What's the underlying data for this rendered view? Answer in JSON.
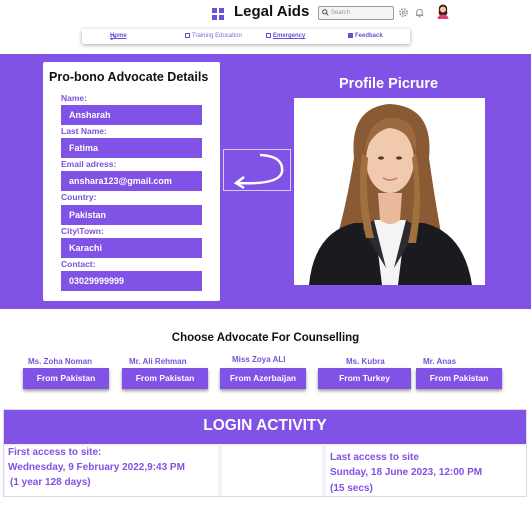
{
  "header": {
    "app_title": "Legal Aids",
    "search_placeholder": "Search",
    "nav": [
      {
        "label": "Home"
      },
      {
        "label": "Training  Education"
      },
      {
        "label": "Emergency"
      },
      {
        "label": "Feedback"
      }
    ]
  },
  "details": {
    "title": "Pro-bono Advocate Details",
    "fields": [
      {
        "label": "Name:",
        "value": "Ansharah"
      },
      {
        "label": "Last Name:",
        "value": "Fatima"
      },
      {
        "label": "Email adress:",
        "value": "anshara123@gmail.com"
      },
      {
        "label": "Country:",
        "value": "Pakistan"
      },
      {
        "label": "City\\Town:",
        "value": "Karachi"
      },
      {
        "label": "Contact:",
        "value": "03029999999"
      }
    ]
  },
  "profile": {
    "title": "Profile Picrure"
  },
  "counselling": {
    "title": "Choose Advocate For Counselling",
    "advocates": [
      {
        "name": "Ms. Zoha Noman",
        "from": "From Pakistan"
      },
      {
        "name": "Mr. Ali Rehman",
        "from": "From Pakistan"
      },
      {
        "name": "Miss Zoya ALI",
        "from": "From Azerbaijan"
      },
      {
        "name": "Ms. Kubra",
        "from": "From Turkey"
      },
      {
        "name": "Mr. Anas",
        "from": "From Pakistan"
      }
    ]
  },
  "login_activity": {
    "title": "LOGIN ACTIVITY",
    "first": {
      "heading": "First access to site:",
      "date": "Wednesday, 9 February 2022,9:43 PM",
      "ago": "(1 year 128 days)"
    },
    "last": {
      "heading": "Last access to site",
      "date": "Sunday, 18 June 2023, 12:00 PM",
      "ago": "(15 secs)"
    }
  },
  "colors": {
    "accent": "#8052e6",
    "label": "#7a52d9"
  }
}
